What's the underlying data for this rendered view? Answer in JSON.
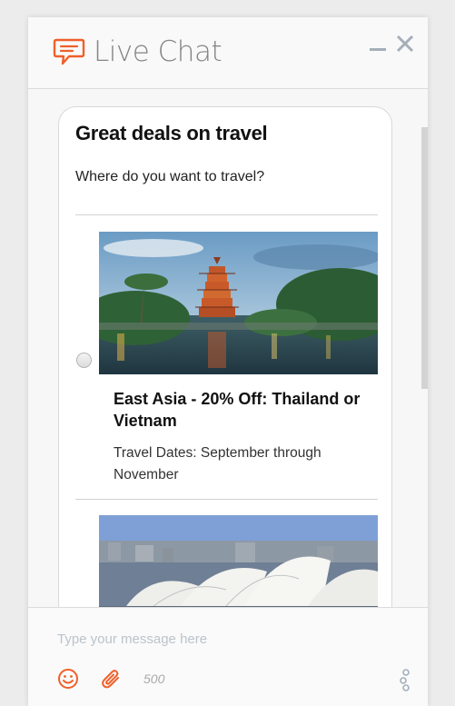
{
  "header": {
    "title": "Live Chat",
    "chat_icon": "chat-bubble-icon",
    "minimize_icon": "minimize-icon",
    "close_icon": "close-icon"
  },
  "card": {
    "title": "Great deals on travel",
    "subtitle": "Where do you want to travel?",
    "options": [
      {
        "title": "East Asia - 20% Off: Thailand or Vietnam",
        "dates": "Travel Dates: September through November",
        "image": "pagoda-lake-photo"
      },
      {
        "image": "sydney-opera-house-photo"
      }
    ]
  },
  "footer": {
    "placeholder": "Type your message here",
    "char_count": "500",
    "emoji_icon": "emoji-icon",
    "attach_icon": "paperclip-icon",
    "menu_icon": "more-vertical-icon"
  },
  "colors": {
    "accent": "#f0602a",
    "title_gray": "#858585",
    "control_gray": "#a4afba"
  }
}
